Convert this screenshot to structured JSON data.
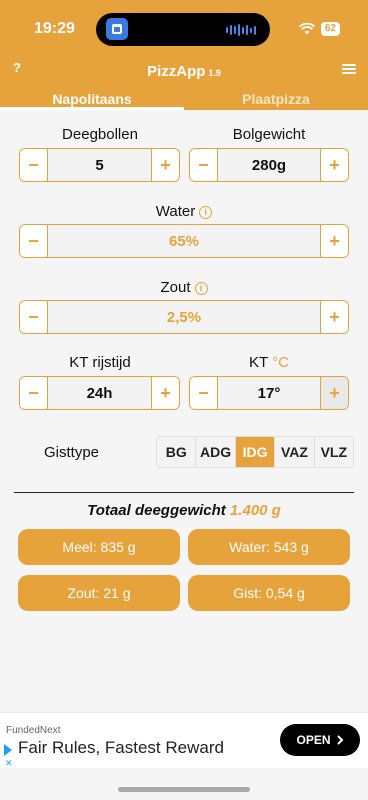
{
  "status": {
    "time": "19:29",
    "battery": "62"
  },
  "header": {
    "help": "?",
    "title": "PizzApp",
    "version": "1.9",
    "tabs": [
      {
        "label": "Napolitaans",
        "active": true
      },
      {
        "label": "Plaatpizza",
        "active": false
      }
    ]
  },
  "form": {
    "dough_balls": {
      "label": "Deegbollen",
      "value": "5"
    },
    "ball_weight": {
      "label": "Bolgewicht",
      "value": "280g"
    },
    "water": {
      "label": "Water",
      "value": "65%"
    },
    "salt": {
      "label": "Zout",
      "value": "2,5%"
    },
    "rise_time": {
      "label": "KT rijstijd",
      "value": "24h"
    },
    "room_temp": {
      "label": "KT",
      "unit": "°C",
      "value": "17°"
    },
    "yeast": {
      "label": "Gisttype",
      "options": [
        "BG",
        "ADG",
        "IDG",
        "VAZ",
        "VLZ"
      ],
      "selected": "IDG"
    },
    "minus": "−",
    "plus": "+",
    "info": "i"
  },
  "results": {
    "total_label": "Totaal deeggewicht",
    "total_value": "1.400 g",
    "flour": "Meel: 835 g",
    "water": "Water: 543 g",
    "salt": "Zout: 21 g",
    "yeast": "Gist: 0,54 g"
  },
  "ad": {
    "brand": "FundedNext",
    "title": "Fair Rules, Fastest Reward",
    "cta": "OPEN",
    "close": "✕"
  },
  "colors": {
    "accent": "#e7a33b",
    "background": "#f5f5f5"
  }
}
